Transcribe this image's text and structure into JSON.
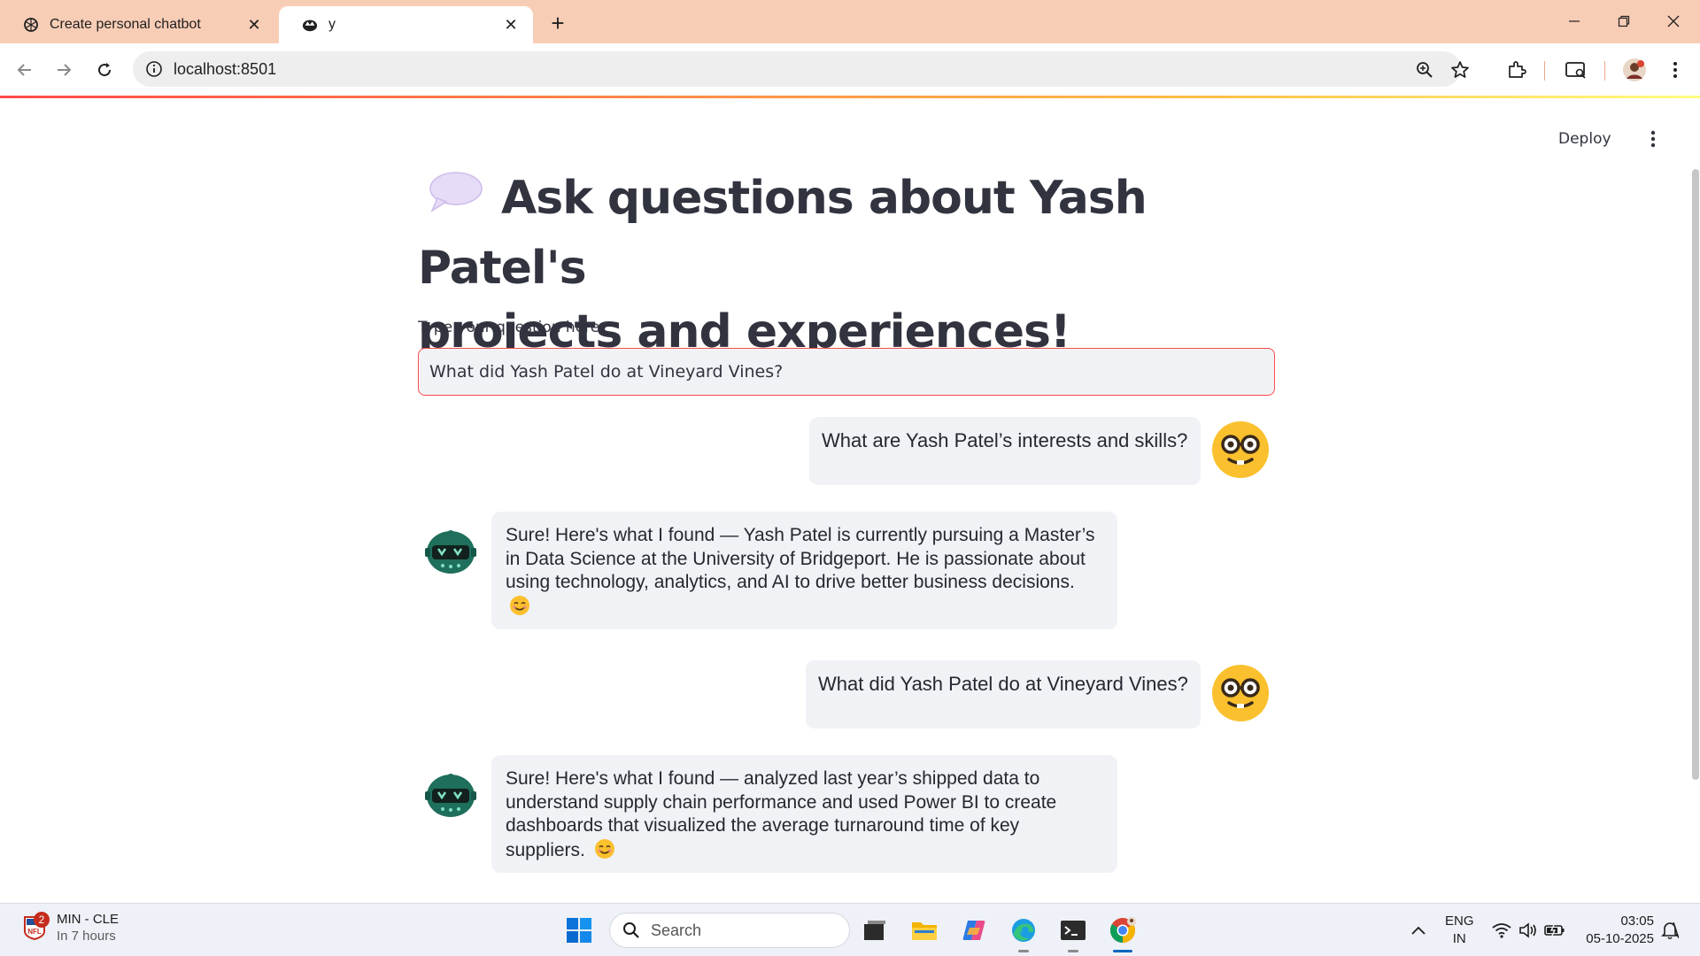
{
  "browser": {
    "tabs": [
      {
        "title": "Create personal chatbot",
        "active": false,
        "favicon": "openai-icon"
      },
      {
        "title": "y",
        "active": true,
        "favicon": "streamlit-crown-icon"
      }
    ],
    "url": "localhost:8501"
  },
  "app": {
    "deploy_label": "Deploy",
    "title_line1": "Ask questions about Yash Patel's",
    "title_line2": "projects and experiences!",
    "title_icon": "speech-balloon-icon",
    "input_label": "Type your question here:",
    "input_value": "What did Yash Patel do at Vineyard Vines?",
    "messages": [
      {
        "role": "user",
        "text": "What are Yash Patel’s interests and skills?",
        "avatar": "nerd-face-avatar"
      },
      {
        "role": "assistant",
        "text": "Sure! Here's what I found — Yash Patel is currently pursuing a Master’s in Data Science at the University of Bridgeport. He is passionate about using technology, analytics, and AI to drive better business decisions.",
        "avatar": "robot-avatar",
        "emoji": "smiling-face-icon"
      },
      {
        "role": "user",
        "text": "What did Yash Patel do at Vineyard Vines?",
        "avatar": "nerd-face-avatar"
      },
      {
        "role": "assistant",
        "text": "Sure! Here's what I found — analyzed last year’s shipped data to understand supply chain performance and used Power BI to create dashboards that visualized the average turnaround time of key suppliers.",
        "avatar": "robot-avatar",
        "emoji": "smiling-face-icon"
      }
    ]
  },
  "taskbar": {
    "weather_line1": "MIN - CLE",
    "weather_line2": "In 7 hours",
    "nfl_badge": "2",
    "search_placeholder": "Search",
    "lang_line1": "ENG",
    "lang_line2": "IN",
    "time": "03:05",
    "date": "05-10-2025"
  },
  "colors": {
    "tabstrip": "#f8cdb6",
    "accent_red": "#ff4b4b",
    "chat_bubble": "#f0f2f6",
    "text": "#31333f"
  }
}
